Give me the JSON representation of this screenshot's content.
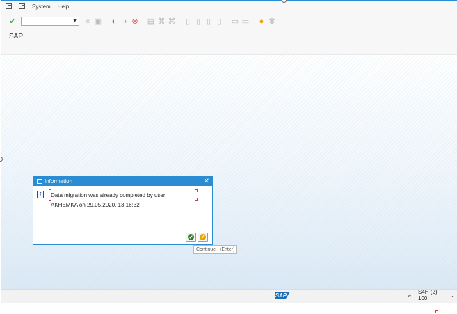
{
  "menu": {
    "items": [
      {
        "label": "System"
      },
      {
        "label": "Help"
      }
    ]
  },
  "toolbar": {
    "command_value": "",
    "icons": [
      "enter-icon",
      "back-icon",
      "exit-icon",
      "cancel-icon",
      "print-icon",
      "find-icon",
      "help-icon",
      "settings-icon"
    ]
  },
  "screen": {
    "title": "SAP"
  },
  "dialog": {
    "title": "Information",
    "close_glyph": "✕",
    "message_line1": "Data migration was already completed by user",
    "message_line2": "AKHEMKA on 29.05.2020, 13:16:32",
    "continue_glyph": "✔",
    "help_glyph": "?"
  },
  "tooltip": {
    "label": "Continue",
    "shortcut": "(Enter)"
  },
  "statusbar": {
    "logo": "SAP",
    "expand_glyph": "»",
    "system_info": "S4H (2) 100",
    "dropdown_glyph": "⌄"
  },
  "colors": {
    "accent": "#2a8dd4",
    "ok_green": "#3a7a2a",
    "help_orange": "#e8a400"
  }
}
